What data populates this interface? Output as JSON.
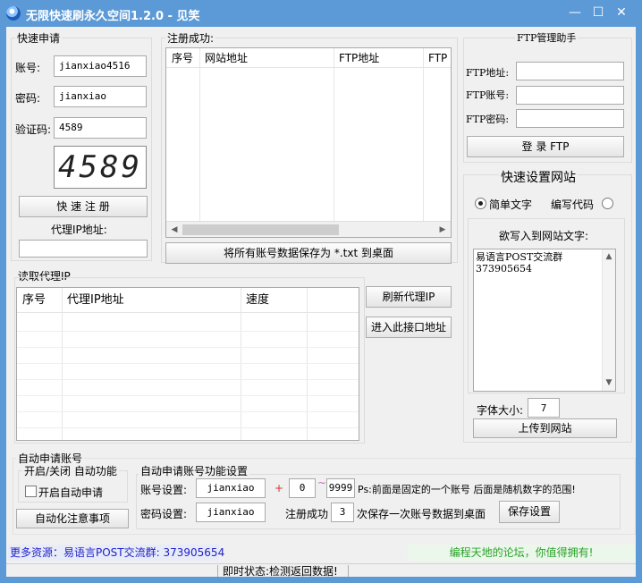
{
  "window": {
    "title": "无限快速刷永久空间1.2.0 - 见笑",
    "icon": "globe-icon",
    "minimize": "—",
    "maximize": "☐",
    "close": "✕"
  },
  "quick_apply": {
    "group_title": "快速申请",
    "account_label": "账号:",
    "account_value": "jianxiao4516",
    "password_label": "密码:",
    "password_value": "jianxiao",
    "captcha_label": "验证码:",
    "captcha_value": "4589",
    "captcha_image_text": "4589",
    "register_button": "快 速 注 册",
    "proxy_label": "代理IP地址:",
    "proxy_value": ""
  },
  "register_success": {
    "group_title": "注册成功:",
    "columns": [
      "序号",
      "网站地址",
      "FTP地址",
      "FTP"
    ],
    "save_button": "将所有账号数据保存为 *.txt 到桌面"
  },
  "ftp_helper": {
    "group_title": "FTP管理助手",
    "address_label": "FTP地址:",
    "account_label": "FTP账号:",
    "password_label": "FTP密码:",
    "address_value": "",
    "account_value": "",
    "password_value": "",
    "login_button": "登 录 FTP"
  },
  "site_setup": {
    "title": "快速设置网站",
    "option_simple": "简单文字",
    "option_code": "编写代码",
    "selected": "简单文字",
    "write_label": "欲写入到网站文字:",
    "text_lines": [
      "易语言POST交流群",
      "373905654"
    ],
    "font_size_label": "字体大小:",
    "font_size_value": "7",
    "upload_button": "上传到网站"
  },
  "proxy_list": {
    "group_title": "读取代理IP",
    "columns": [
      "序号",
      "代理IP地址",
      "速度"
    ],
    "refresh_button": "刷新代理IP",
    "enter_button": "进入此接口地址"
  },
  "auto_apply": {
    "group_title": "自动申请账号",
    "toggle_title": "开启/关闭 自动功能",
    "checkbox_label": "开启自动申请",
    "notes_button": "自动化注意事项",
    "settings_title": "自动申请账号功能设置",
    "account_setting_label": "账号设置:",
    "account_prefix": "jianxiao",
    "plus": "+",
    "range_from": "0",
    "tilde": "~",
    "range_to": "9999",
    "range_hint": "Ps:前面是固定的一个账号 后面是随机数字的范围!",
    "password_setting_label": "密码设置:",
    "password_value": "jianxiao",
    "save_every_label": "注册成功",
    "save_every_value": "3",
    "save_every_suffix": "次保存一次账号数据到桌面",
    "save_settings_button": "保存设置"
  },
  "footer": {
    "more_resources": "更多资源：易语言POST交流群: 373905654",
    "forum_text": "编程天地的论坛，你值得拥有!",
    "status_text": "即时状态:检测返回数据!"
  }
}
